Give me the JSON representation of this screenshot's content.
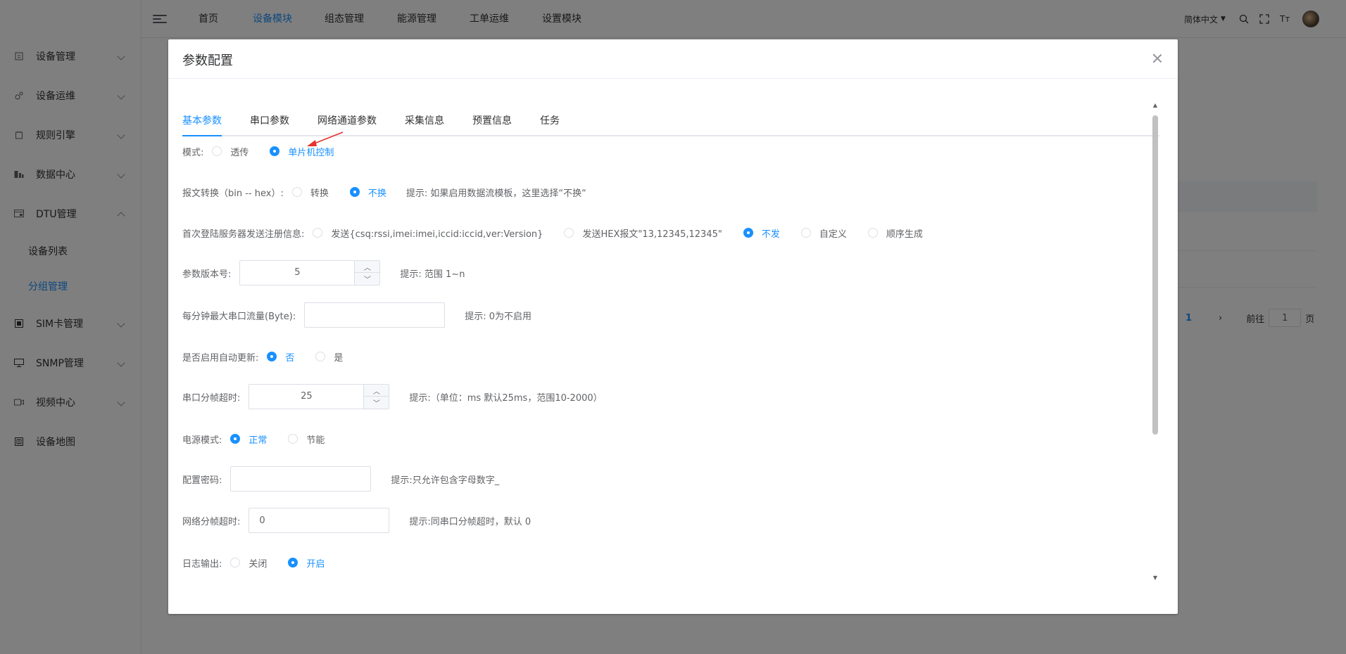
{
  "sidebar": {
    "items": [
      {
        "label": "设备管理",
        "icon": "device-icon"
      },
      {
        "label": "设备运维",
        "icon": "ops-icon"
      },
      {
        "label": "规则引擎",
        "icon": "rule-icon"
      },
      {
        "label": "数据中心",
        "icon": "data-icon"
      },
      {
        "label": "DTU管理",
        "icon": "dtu-icon"
      },
      {
        "label": "SIM卡管理",
        "icon": "sim-icon"
      },
      {
        "label": "SNMP管理",
        "icon": "monitor-icon"
      },
      {
        "label": "视频中心",
        "icon": "video-icon"
      },
      {
        "label": "设备地图",
        "icon": "map-icon"
      }
    ],
    "sub_items": [
      {
        "label": "设备列表"
      },
      {
        "label": "分组管理"
      }
    ]
  },
  "topbar": {
    "nav": [
      "首页",
      "设备模块",
      "组态管理",
      "能源管理",
      "工单运维",
      "设置模块"
    ],
    "active_nav": "设备模块",
    "language": "简体中文",
    "font_size_icon": "Tт"
  },
  "pager": {
    "current": "1",
    "goto_label": "前往",
    "goto_value": "1",
    "page_suffix": "页"
  },
  "dialog": {
    "title": "参数配置",
    "tabs": [
      "基本参数",
      "串口参数",
      "网络通道参数",
      "采集信息",
      "预置信息",
      "任务"
    ],
    "active_tab": "基本参数",
    "mode": {
      "label": "模式:",
      "options": [
        "透传",
        "单片机控制"
      ],
      "selected": "单片机控制"
    },
    "msg_convert": {
      "label": "报文转换（bin -- hex）:",
      "options": [
        "转换",
        "不换"
      ],
      "selected": "不换",
      "hint": "提示: 如果启用数据流模板，这里选择“不换“"
    },
    "first_login": {
      "label": "首次登陆服务器发送注册信息:",
      "options": [
        "发送{csq:rssi,imei:imei,iccid:iccid,ver:Version}",
        "发送HEX报文\"13,12345,12345\"",
        "不发",
        "自定义",
        "顺序生成"
      ],
      "selected": "不发"
    },
    "param_version": {
      "label": "参数版本号:",
      "value": "5",
      "hint": "提示: 范围 1~n"
    },
    "max_serial_flow": {
      "label": "每分钟最大串口流量(Byte):",
      "value": "",
      "hint": "提示: 0为不启用"
    },
    "auto_update": {
      "label": "是否启用自动更新:",
      "options": [
        "否",
        "是"
      ],
      "selected": "否"
    },
    "serial_frame_timeout": {
      "label": "串口分帧超时:",
      "value": "25",
      "hint": "提示:（单位：ms 默认25ms，范围10-2000）"
    },
    "power_mode": {
      "label": "电源模式:",
      "options": [
        "正常",
        "节能"
      ],
      "selected": "正常"
    },
    "config_password": {
      "label": "配置密码:",
      "value": "",
      "hint": "提示:只允许包含字母数字_"
    },
    "net_frame_timeout": {
      "label": "网络分帧超时:",
      "value": "0",
      "hint": "提示:同串口分帧超时，默认 0"
    },
    "log_output": {
      "label": "日志输出:",
      "options": [
        "关闭",
        "开启"
      ],
      "selected": "开启"
    }
  },
  "colors": {
    "accent": "#1890ff",
    "overlay": "rgba(0,0,0,0.5)",
    "annotation": "#e8322d"
  }
}
